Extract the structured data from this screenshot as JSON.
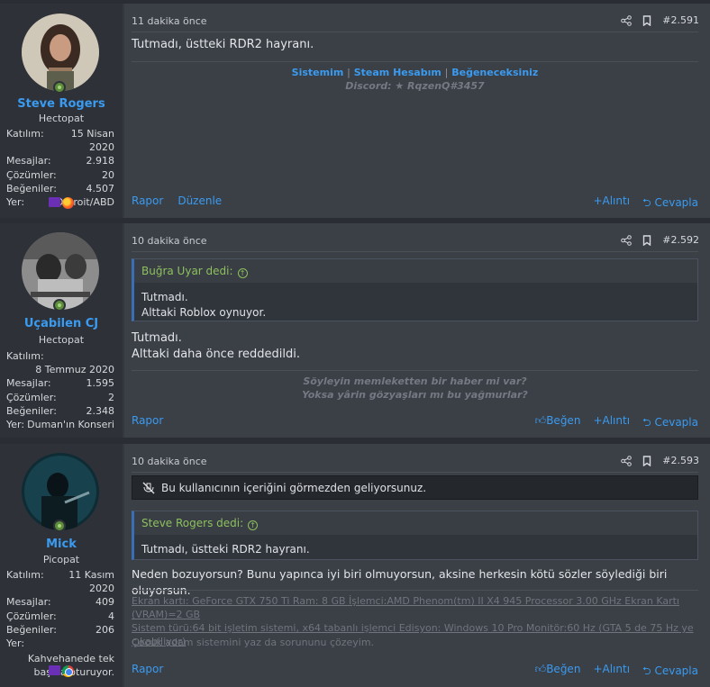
{
  "posts": [
    {
      "time": "11 dakika önce",
      "number": "#2.591",
      "username": "Steve Rogers",
      "user_title": "Hectopat",
      "stats": [
        {
          "k": "Katılım:",
          "v": "15 Nisan 2020"
        },
        {
          "k": "Mesajlar:",
          "v": "2.918"
        },
        {
          "k": "Çözümler:",
          "v": "20"
        },
        {
          "k": "Beğeniler:",
          "v": "4.507"
        },
        {
          "k": "Yer:",
          "v": "Detroit/ABD"
        }
      ],
      "text": "Tutmadı, üstteki RDR2 hayranı.",
      "signature": {
        "link1": "Sistemim",
        "sep1": "|",
        "link2": "Steam Hesabım",
        "sep2": "|",
        "link3": "Beğeneceksiniz",
        "discord": "Discord: ★ RqzenQ#3457"
      },
      "footer": {
        "report": "Rapor",
        "edit": "Düzenle",
        "quote": "Alıntı",
        "reply": "Cevapla"
      }
    },
    {
      "time": "10 dakika önce",
      "number": "#2.592",
      "username": "Uçabilen CJ",
      "user_title": "Hectopat",
      "stats": [
        {
          "k": "Katılım:",
          "v": ""
        },
        {
          "k": "",
          "v": "8 Temmuz 2020"
        },
        {
          "k": "Mesajlar:",
          "v": "1.595"
        },
        {
          "k": "Çözümler:",
          "v": "2"
        },
        {
          "k": "Beğeniler:",
          "v": "2.348"
        },
        {
          "k": "Yer:",
          "v": "Duman'ın Konseri"
        }
      ],
      "quote_author": "Buğra Uyar dedi:",
      "quote_lines": [
        "Tutmadı.",
        "Alttaki Roblox oynuyor."
      ],
      "text_lines": [
        "Tutmadı.",
        "Alttaki daha önce reddedildi."
      ],
      "signature_lines": [
        "Söyleyin memleketten bir haber mi var?",
        "Yoksa yârin gözyaşları mı bu yağmurlar?"
      ],
      "footer": {
        "report": "Rapor",
        "like": "Beğen",
        "quote": "Alıntı",
        "reply": "Cevapla"
      }
    },
    {
      "time": "10 dakika önce",
      "number": "#2.593",
      "username": "Mick",
      "user_title": "Picopat",
      "stats": [
        {
          "k": "Katılım:",
          "v": "11 Kasım 2020"
        },
        {
          "k": "Mesajlar:",
          "v": "409"
        },
        {
          "k": "Çözümler:",
          "v": "4"
        },
        {
          "k": "Beğeniler:",
          "v": "206"
        },
        {
          "k": "Yer:",
          "v": ""
        }
      ],
      "location_lines": [
        "Kahvehanede tek",
        "başına oturuyor."
      ],
      "ignored_notice": "Bu kullanıcının içeriğini görmezden geliyorsunuz.",
      "quote_author": "Steve Rogers dedi:",
      "quote_lines": [
        "Tutmadı, üstteki RDR2 hayranı."
      ],
      "text": "Neden bozuyorsun? Bunu yapınca iyi biri olmuyorsun, aksine herkesin kötü sözler söylediği biri oluyorsun.",
      "pc_line1": "Ekran kartı: GeForce GTX 750 Ti Ram: 8 GB İşlemci:AMD Phenom(tm) II X4 945 Processor 3.00 GHz Ekran Kartı (VRAM)=2 GB",
      "pc_line2": "Sistem türü:64 bit işletim sistemi, x64 tabanlı işlemci Edisyon: Windows 10 Pro Monitör:60 Hz (GTA 5 de 75 Hz ye çıkabiliyor)",
      "quiet_line": "Çocuk adam sistemini yaz da sorununu çözeyim.",
      "footer": {
        "report": "Rapor",
        "like": "Beğen",
        "quote": "Alıntı",
        "reply": "Cevapla"
      }
    }
  ]
}
